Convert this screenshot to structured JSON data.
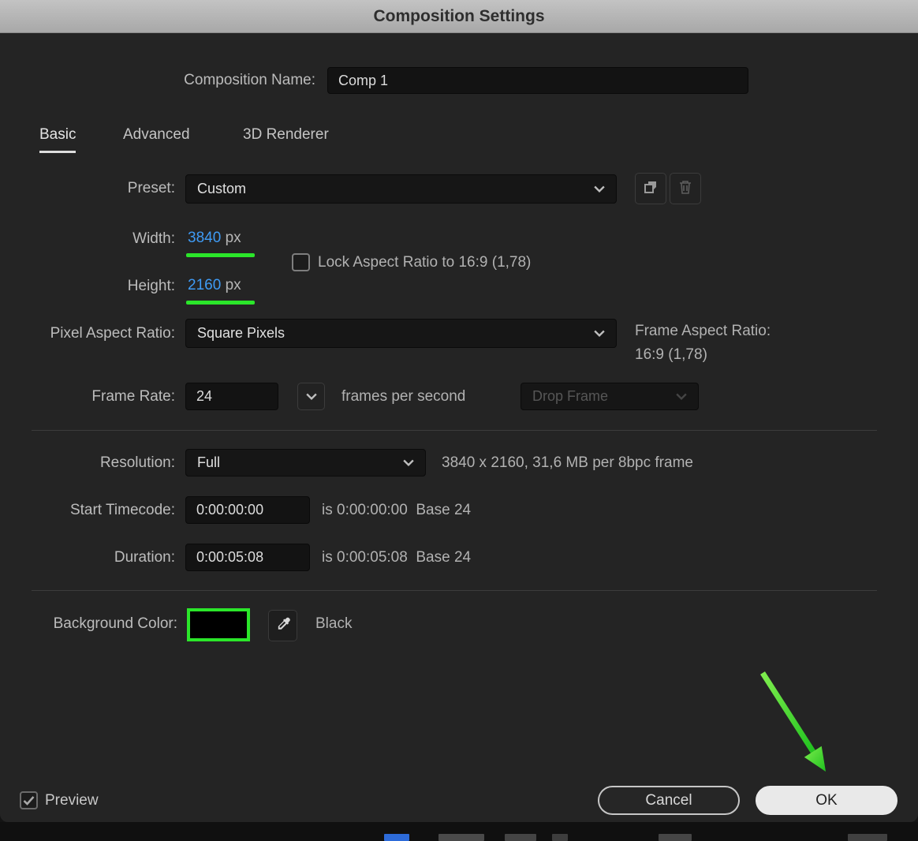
{
  "dialog": {
    "title": "Composition Settings",
    "composition_name": {
      "label": "Composition Name:",
      "value": "Comp 1"
    },
    "tabs": [
      {
        "label": "Basic"
      },
      {
        "label": "Advanced"
      },
      {
        "label": "3D Renderer"
      }
    ],
    "preset": {
      "label": "Preset:",
      "value": "Custom"
    },
    "dimensions": {
      "width": {
        "label": "Width:",
        "value": "3840",
        "unit": "px"
      },
      "height": {
        "label": "Height:",
        "value": "2160",
        "unit": "px"
      },
      "lock_aspect_label": "Lock Aspect Ratio to 16:9 (1,78)",
      "lock_aspect_checked": false
    },
    "pixel_aspect_ratio": {
      "label": "Pixel Aspect Ratio:",
      "value": "Square Pixels"
    },
    "frame_aspect_ratio": {
      "label": "Frame Aspect Ratio:",
      "value": "16:9 (1,78)"
    },
    "frame_rate": {
      "label": "Frame Rate:",
      "value": "24",
      "suffix": "frames per second",
      "drop_frame_value": "Drop Frame"
    },
    "resolution": {
      "label": "Resolution:",
      "value": "Full",
      "info": "3840 x 2160, 31,6 MB per 8bpc frame"
    },
    "start_timecode": {
      "label": "Start Timecode:",
      "value": "0:00:00:00",
      "info": "is 0:00:00:00  Base 24"
    },
    "duration": {
      "label": "Duration:",
      "value": "0:00:05:08",
      "info": "is 0:00:05:08  Base 24"
    },
    "background_color": {
      "label": "Background Color:",
      "swatch_color": "#000000",
      "color_name": "Black"
    },
    "footer": {
      "preview_label": "Preview",
      "preview_checked": true,
      "cancel_label": "Cancel",
      "ok_label": "OK"
    }
  },
  "annotations": {
    "green": "#2be62a"
  },
  "colors": {
    "value_blue": "#3f9bf5",
    "dialog_bg": "#242424",
    "titlebar_gray": "#b5b5b5"
  }
}
